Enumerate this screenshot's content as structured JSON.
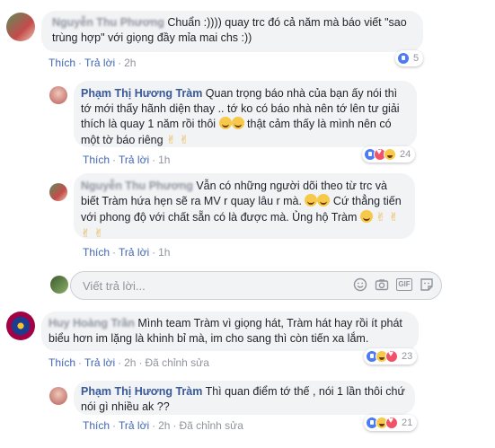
{
  "comments": [
    {
      "author": "Nguyễn Thu Phương",
      "text": " Chuẩn :)))) quay trc đó cả năm mà báo viết \"sao trùng hợp\" với giọng đầy mỉa mai chs :))",
      "like_label": "Thích",
      "reply_label": "Trả lời",
      "time": "2h",
      "reaction_count": "5"
    },
    {
      "author": "Phạm Thị Hương Tràm",
      "text_a": " Quan trọng báo nhà của bạn ấy nói thì tớ mới thấy hãnh diện thay .. tớ ko có báo nhà nên tớ lên tư giải thích là quay 1 năm rồi thôi ",
      "text_b": " thật cảm thấy là mình nên có một tờ báo riêng ",
      "victory": "✌ ✌",
      "like_label": "Thích",
      "reply_label": "Trả lời",
      "time": "1h",
      "reaction_count": "24"
    },
    {
      "author": "Nguyễn Thu Phương",
      "text_a": " Vẫn có những người dõi theo từ trc và biết Tràm hứa hẹn sẽ ra MV r quay lâu r mà. ",
      "text_b": " Cứ thẳng tiến với phong độ với chất sẵn có là được mà. Ủng hộ Tràm ",
      "victory": "✌ ✌ ✌ ✌",
      "like_label": "Thích",
      "reply_label": "Trả lời",
      "time": "1h"
    },
    {
      "author": "Huy Hoàng Trần",
      "text": " Mình team Tràm vì giọng hát, Tràm hát hay rồi ít phát biểu hơn im lặng là khinh bỉ mà, im cho sang thì còn tiến xa lắm.",
      "like_label": "Thích",
      "reply_label": "Trả lời",
      "time": "2h",
      "edited": "Đã chỉnh sửa",
      "reaction_count": "23"
    },
    {
      "author": "Phạm Thị Hương Tràm",
      "text": " Thì quan điểm tớ thế , nói 1 lần thôi chứ nói gì nhiều ak ??",
      "like_label": "Thích",
      "reply_label": "Trả lời",
      "time": "2h",
      "edited": "Đã chỉnh sửa",
      "reaction_count": "21"
    }
  ],
  "reply_box": {
    "placeholder": "Viết trả lời..."
  },
  "icons": [
    "emoji-icon",
    "camera-icon",
    "gif-icon",
    "sticker-icon"
  ],
  "colors": {
    "link": "#4267b2",
    "author": "#385898",
    "bubble": "#f2f3f5"
  }
}
